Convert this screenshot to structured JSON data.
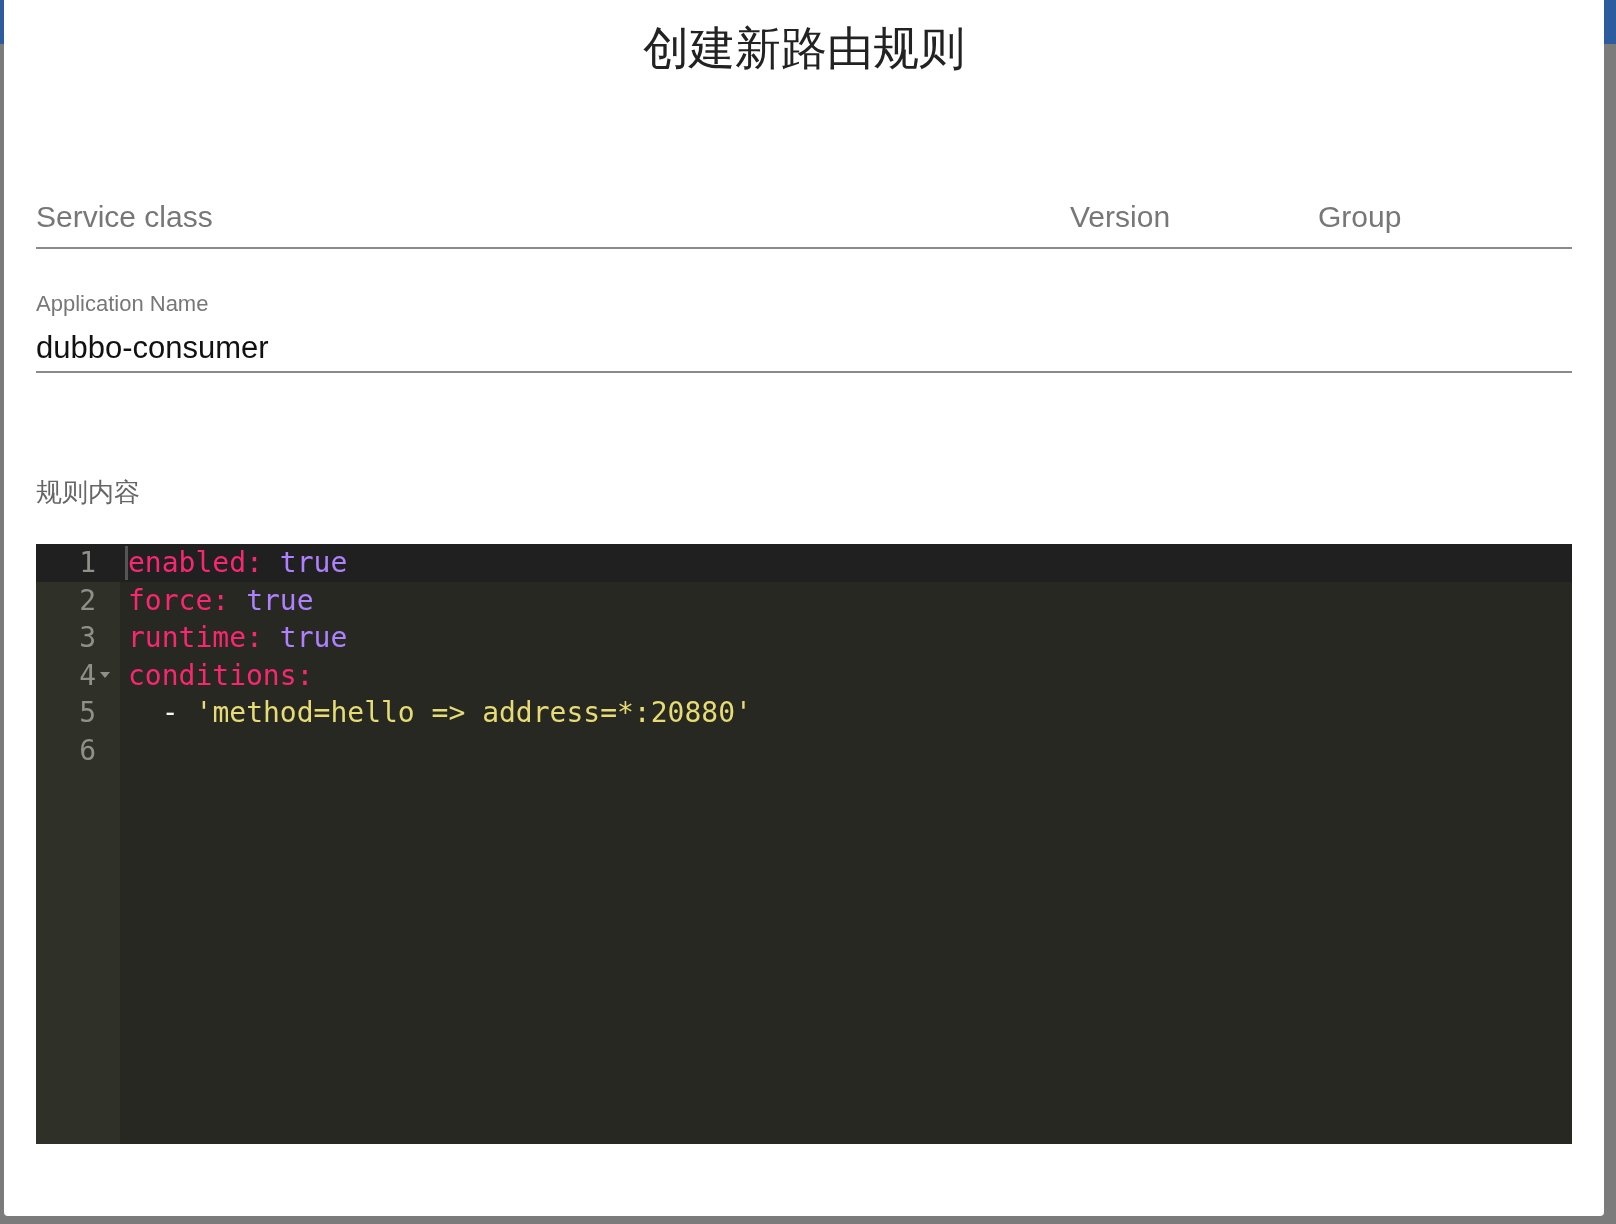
{
  "dialog": {
    "title": "创建新路由规则"
  },
  "service_fields": [
    {
      "kind": "service",
      "placeholder": "Service class"
    },
    {
      "kind": "version",
      "placeholder": "Version"
    },
    {
      "kind": "group",
      "placeholder": "Group"
    }
  ],
  "application": {
    "label": "Application Name",
    "value": "dubbo-consumer"
  },
  "rule_content_label": "规则内容",
  "editor": {
    "lines": [
      {
        "number": "1",
        "active": true,
        "foldable": false,
        "tokens": [
          {
            "kind": "key",
            "text": "enabled:"
          },
          {
            "kind": "bool",
            "text": "true"
          }
        ]
      },
      {
        "number": "2",
        "active": false,
        "foldable": false,
        "tokens": [
          {
            "kind": "key",
            "text": "force:"
          },
          {
            "kind": "bool",
            "text": "true"
          }
        ]
      },
      {
        "number": "3",
        "active": false,
        "foldable": false,
        "tokens": [
          {
            "kind": "key",
            "text": "runtime:"
          },
          {
            "kind": "bool",
            "text": "true"
          }
        ]
      },
      {
        "number": "4",
        "active": false,
        "foldable": true,
        "tokens": [
          {
            "kind": "key",
            "text": "conditions:"
          }
        ]
      },
      {
        "number": "5",
        "active": false,
        "foldable": false,
        "tokens": [
          {
            "kind": "plain",
            "text": "  -"
          },
          {
            "kind": "string",
            "text": "'method=hello => address=*:20880'"
          }
        ]
      },
      {
        "number": "6",
        "active": false,
        "foldable": false
      }
    ]
  }
}
